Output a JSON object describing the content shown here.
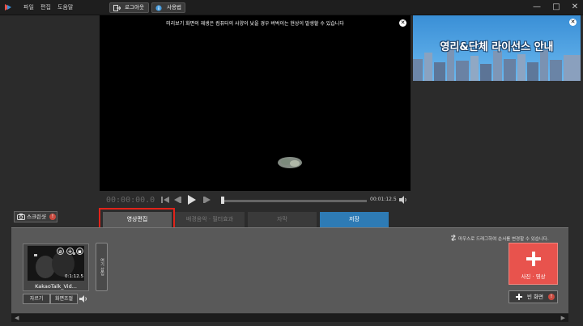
{
  "menu": {
    "file": "파일",
    "edit": "편집",
    "help": "도움말"
  },
  "toolbar": {
    "logout": "로그아웃",
    "manual": "사용법"
  },
  "window_controls": {
    "minimize": "—",
    "maximize": "□",
    "close": "✕"
  },
  "preview": {
    "notice": "미리보기 화면의 재생은 컴퓨터의 사양이 낮을 경우 버벅이는 현상이 발생할 수 있습니다",
    "close": "✕",
    "current_time": "00:00:00.0",
    "duration": "00:01:12.5"
  },
  "banner": {
    "title": "영리&단체 라이선스 안내",
    "close": "✕"
  },
  "screenshot": {
    "label": "스크린샷"
  },
  "tabs": [
    {
      "label": "영상편집"
    },
    {
      "label": "배경음악 · 필터효과"
    },
    {
      "label": "자막"
    },
    {
      "label": "저장"
    }
  ],
  "editor": {
    "hint": "마우스로 드래그하여 순서를 변경할 수 있습니다.",
    "clip": {
      "duration": "0:1:12.5",
      "name": "KakaoTalk_Vid...",
      "trim": "자르기",
      "adjust": "화면조절"
    },
    "insert": "여기 삽입",
    "add_label": "사진 · 영상",
    "blank_label": "빈 화면"
  },
  "colors": {
    "accent_red": "#e8534d",
    "save_blue": "#2e7bb5",
    "highlight": "#e2231a"
  }
}
